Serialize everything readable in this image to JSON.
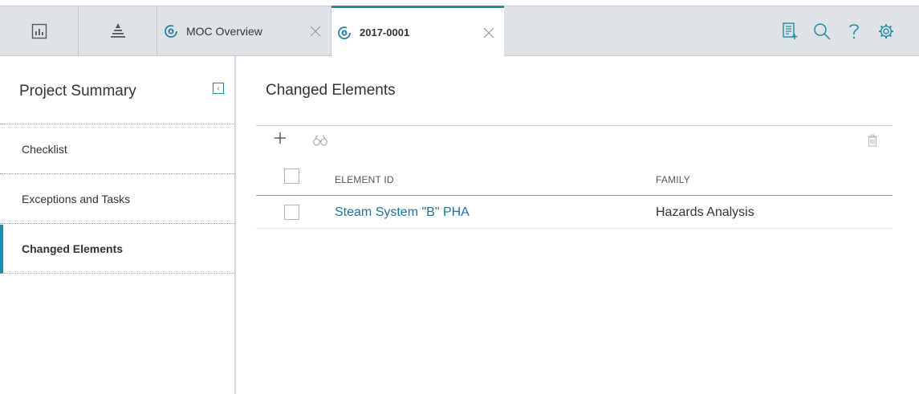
{
  "tabs": {
    "icon_tabs": [
      {
        "icon": "dashboard-icon"
      },
      {
        "icon": "asset-hierarchy-icon"
      }
    ],
    "doc_tabs": [
      {
        "label": "MOC Overview",
        "icon": "moc-refresh-icon",
        "active": false
      },
      {
        "label": "2017-0001",
        "icon": "moc-refresh-icon",
        "active": true
      }
    ],
    "tools": [
      "new-document-icon",
      "search-icon",
      "help-icon",
      "settings-icon"
    ]
  },
  "sidebar": {
    "title": "Project Summary",
    "items": [
      {
        "label": "Checklist",
        "active": false
      },
      {
        "label": "Exceptions and Tasks",
        "active": false
      },
      {
        "label": "Changed Elements",
        "active": true
      }
    ]
  },
  "main": {
    "title": "Changed Elements",
    "table": {
      "columns": [
        "ELEMENT ID",
        "FAMILY"
      ],
      "rows": [
        {
          "element_id": "Steam System \"B\" PHA",
          "family": "Hazards Analysis"
        }
      ]
    }
  },
  "colors": {
    "accent": "#1f8ba6",
    "link": "#1f6fa8",
    "tabbar": "#dfe3e8"
  }
}
